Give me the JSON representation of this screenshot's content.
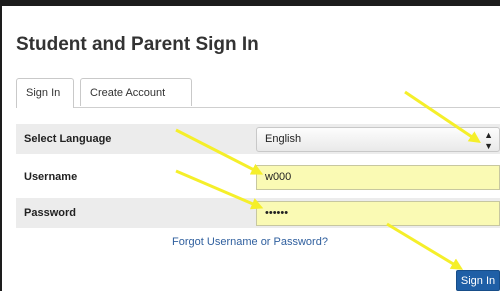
{
  "page": {
    "title": "Student and Parent Sign In"
  },
  "tabs": [
    {
      "label": "Sign In",
      "active": true
    },
    {
      "label": "Create Account",
      "active": false
    }
  ],
  "form": {
    "language": {
      "label": "Select Language",
      "value": "English"
    },
    "username": {
      "label": "Username",
      "value": "w000"
    },
    "password": {
      "label": "Password",
      "value": "••••••"
    }
  },
  "links": {
    "forgot": "Forgot Username or Password?"
  },
  "actions": {
    "sign_in": "Sign In"
  },
  "colors": {
    "accent": "#1f5fa6",
    "autofill": "#fafab4",
    "annotation": "#f5ef2a"
  }
}
